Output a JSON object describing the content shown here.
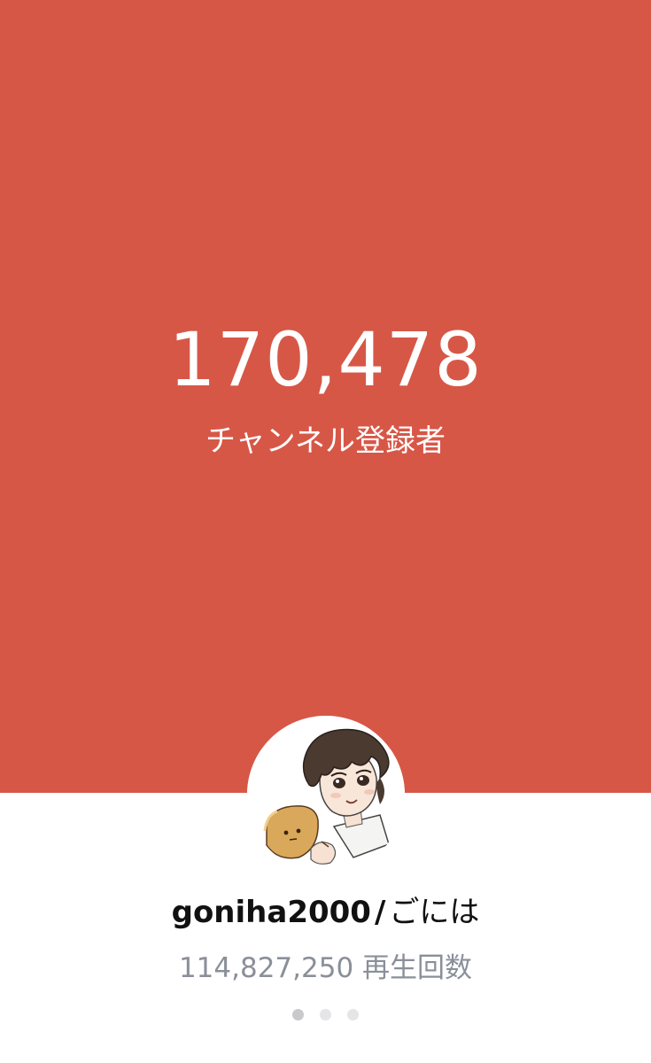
{
  "stats": {
    "subscriber_count": "170,478",
    "subscriber_label": "チャンネル登録者"
  },
  "channel": {
    "handle": "goniha2000",
    "separator": "/",
    "display_name": "ごには",
    "view_count": "114,827,250",
    "view_label": "再生回数",
    "avatar": "anime-boy-portrait-icon"
  },
  "pagination": {
    "total": 3,
    "active_index": 0
  },
  "colors": {
    "accent": "#d75747",
    "muted_text": "#8a8f99",
    "dot_active": "#c9c9cc",
    "dot_inactive": "#e5e5e8"
  }
}
